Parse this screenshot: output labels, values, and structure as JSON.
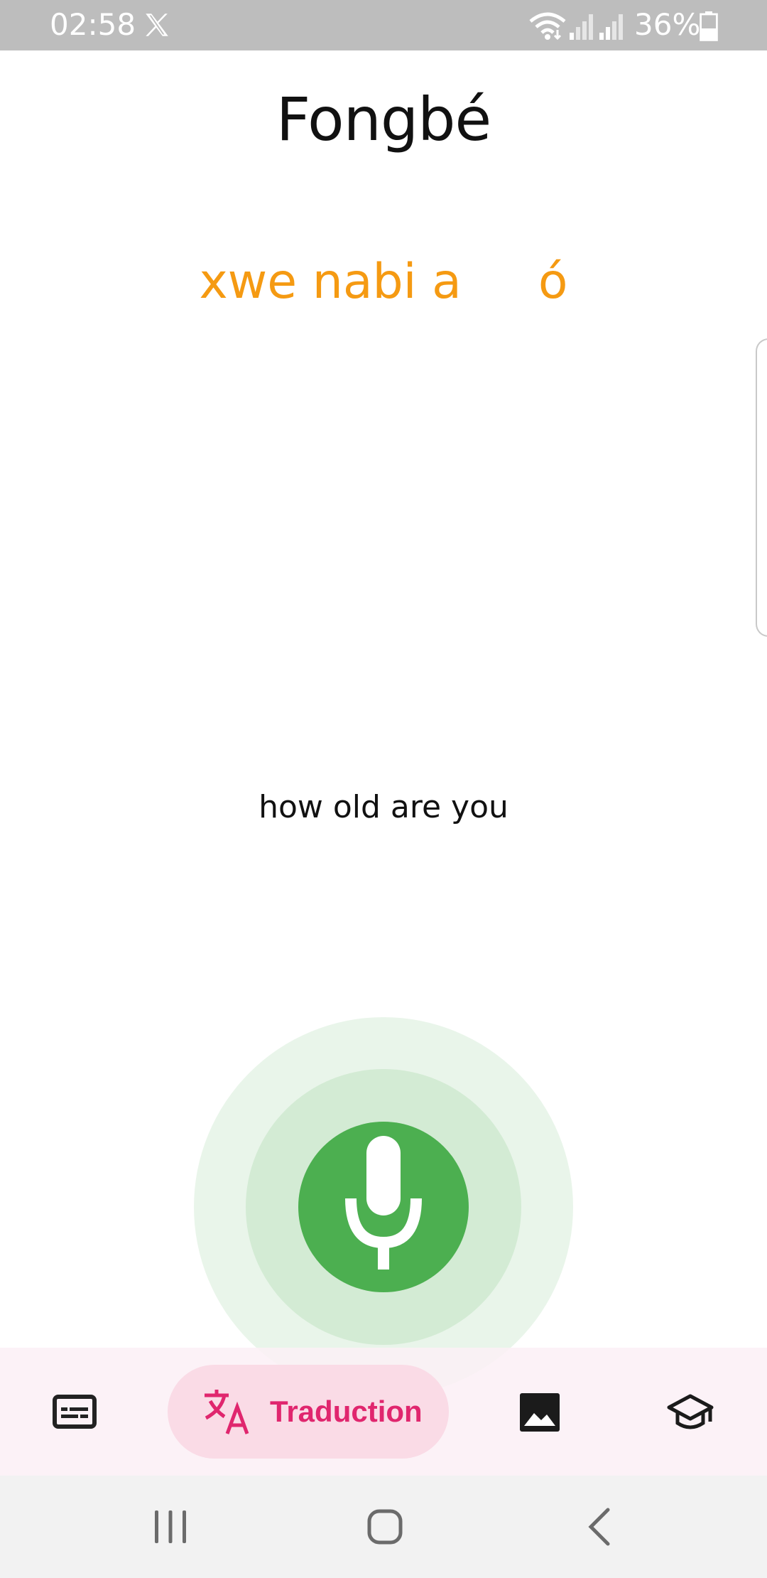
{
  "status_bar": {
    "time": "02:58",
    "battery_percent": "36%",
    "icons": [
      "x-app-icon",
      "wifi-icon",
      "signal-icon",
      "signal-icon",
      "battery-icon"
    ]
  },
  "header": {
    "title": "Fongbé"
  },
  "translation": {
    "output_text": "xwe nabi a     ó",
    "output_color": "#f59a12",
    "input_text": "how old are you"
  },
  "mic": {
    "icon": "microphone-icon",
    "accent_color": "#4caf50"
  },
  "bottom_nav": {
    "items": [
      {
        "icon": "subtitles-icon",
        "label": ""
      },
      {
        "icon": "translate-icon",
        "label": "Traduction",
        "selected": true
      },
      {
        "icon": "image-icon",
        "label": ""
      },
      {
        "icon": "graduation-cap-icon",
        "label": ""
      }
    ],
    "accent_color": "#e0266e"
  },
  "system_nav": {
    "buttons": [
      "recent-apps-icon",
      "home-icon",
      "back-icon"
    ]
  }
}
